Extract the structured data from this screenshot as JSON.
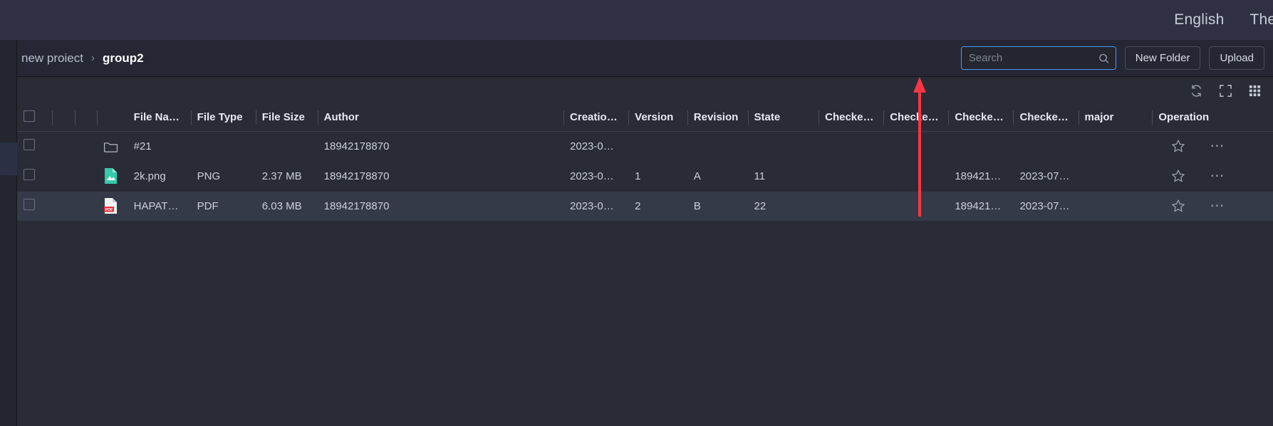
{
  "topbar": {
    "links": [
      {
        "label": "English",
        "name": "language-switcher"
      },
      {
        "label": "Them",
        "name": "theme-switcher"
      }
    ]
  },
  "breadcrumb": {
    "root": "new proiect",
    "separator": "›",
    "current": "group2"
  },
  "search": {
    "value": "",
    "placeholder": "Search",
    "icon": "search-icon"
  },
  "actions": {
    "new_folder": "New Folder",
    "upload": "Upload"
  },
  "grid_tools": [
    {
      "name": "refresh-icon",
      "label": "Refresh"
    },
    {
      "name": "fullscreen-icon",
      "label": "Fullscreen"
    },
    {
      "name": "column-settings-icon",
      "label": "Columns"
    }
  ],
  "table": {
    "columns": [
      {
        "key": "checkbox",
        "label": ""
      },
      {
        "key": "h1",
        "label": ""
      },
      {
        "key": "h2",
        "label": ""
      },
      {
        "key": "icon",
        "label": ""
      },
      {
        "key": "name",
        "label": "File Na…"
      },
      {
        "key": "type",
        "label": "File Type"
      },
      {
        "key": "size",
        "label": "File Size"
      },
      {
        "key": "author",
        "label": "Author"
      },
      {
        "key": "creation",
        "label": "Creatio…"
      },
      {
        "key": "version",
        "label": "Version"
      },
      {
        "key": "revision",
        "label": "Revision"
      },
      {
        "key": "state",
        "label": "State"
      },
      {
        "key": "checked1",
        "label": "Checke…"
      },
      {
        "key": "checked2",
        "label": "Checke…"
      },
      {
        "key": "checked3",
        "label": "Checke…"
      },
      {
        "key": "checked4",
        "label": "Checke…"
      },
      {
        "key": "major",
        "label": "major"
      },
      {
        "key": "operation",
        "label": "Operation"
      }
    ],
    "rows": [
      {
        "icon": "folder-icon",
        "name": "#21",
        "type": "",
        "size": "",
        "author": "18942178870",
        "creation": "2023-0…",
        "version": "",
        "revision": "",
        "state": "",
        "checked1": "",
        "checked2": "",
        "checked3": "",
        "checked4": "",
        "major": "",
        "selected": false
      },
      {
        "icon": "png-file-icon",
        "name": "2k.png",
        "type": "PNG",
        "size": "2.37 MB",
        "author": "18942178870",
        "creation": "2023-0…",
        "version": "1",
        "revision": "A",
        "state": "11",
        "checked1": "",
        "checked2": "",
        "checked3": "189421…",
        "checked4": "2023-07…",
        "major": "",
        "selected": false
      },
      {
        "icon": "pdf-file-icon",
        "name": "HAPAT…",
        "type": "PDF",
        "size": "6.03 MB",
        "author": "18942178870",
        "creation": "2023-0…",
        "version": "2",
        "revision": "B",
        "state": "22",
        "checked1": "",
        "checked2": "",
        "checked3": "189421…",
        "checked4": "2023-07…",
        "major": "",
        "selected": true
      }
    ],
    "row_operations": {
      "favorite": "star-icon",
      "more": "more-options-icon"
    }
  },
  "annotation": {
    "arrow_color": "#f5222d",
    "name": "annotation-arrow"
  },
  "colors": {
    "accent": "#4b9cf5",
    "background": "#2b2d3a",
    "panel": "#252734",
    "selected_row": "#343a48",
    "png_icon": "#36c9ab",
    "pdf_icon": "#e8333a"
  }
}
